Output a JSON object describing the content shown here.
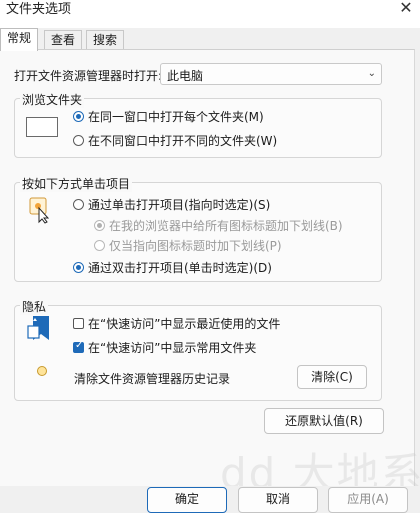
{
  "window": {
    "title": "文件夹选项"
  },
  "tabs": [
    {
      "label": "常规",
      "active": true
    },
    {
      "label": "查看",
      "active": false
    },
    {
      "label": "搜索",
      "active": false
    }
  ],
  "open_explorer": {
    "label": "打开文件资源管理器时打开:",
    "value": "此电脑"
  },
  "browse": {
    "title": "浏览文件夹",
    "options": [
      {
        "label": "在同一窗口中打开每个文件夹(M)",
        "selected": true
      },
      {
        "label": "在不同窗口中打开不同的文件夹(W)",
        "selected": false
      }
    ]
  },
  "click": {
    "title": "按如下方式单击项目",
    "single": {
      "label": "通过单击打开项目(指向时选定)(S)",
      "selected": false
    },
    "sub_options": [
      {
        "label": "在我的浏览器中给所有图标标题加下划线(B)",
        "selected": true,
        "disabled": true
      },
      {
        "label": "仅当指向图标标题时加下划线(P)",
        "selected": false,
        "disabled": true
      }
    ],
    "double": {
      "label": "通过双击打开项目(单击时选定)(D)",
      "selected": true
    }
  },
  "privacy": {
    "title": "隐私",
    "checks": [
      {
        "label": "在“快速访问”中显示最近使用的文件",
        "checked": false
      },
      {
        "label": "在“快速访问”中显示常用文件夹",
        "checked": true
      }
    ],
    "clear_label": "清除文件资源管理器历史记录",
    "clear_button": "清除(C)"
  },
  "restore_button": "还原默认值(R)",
  "footer": {
    "ok": "确定",
    "cancel": "取消",
    "apply": "应用(A)"
  },
  "colors": {
    "accent": "#1e6ab8",
    "panel": "#f9f9f9",
    "chrome": "#f0f0f0"
  }
}
